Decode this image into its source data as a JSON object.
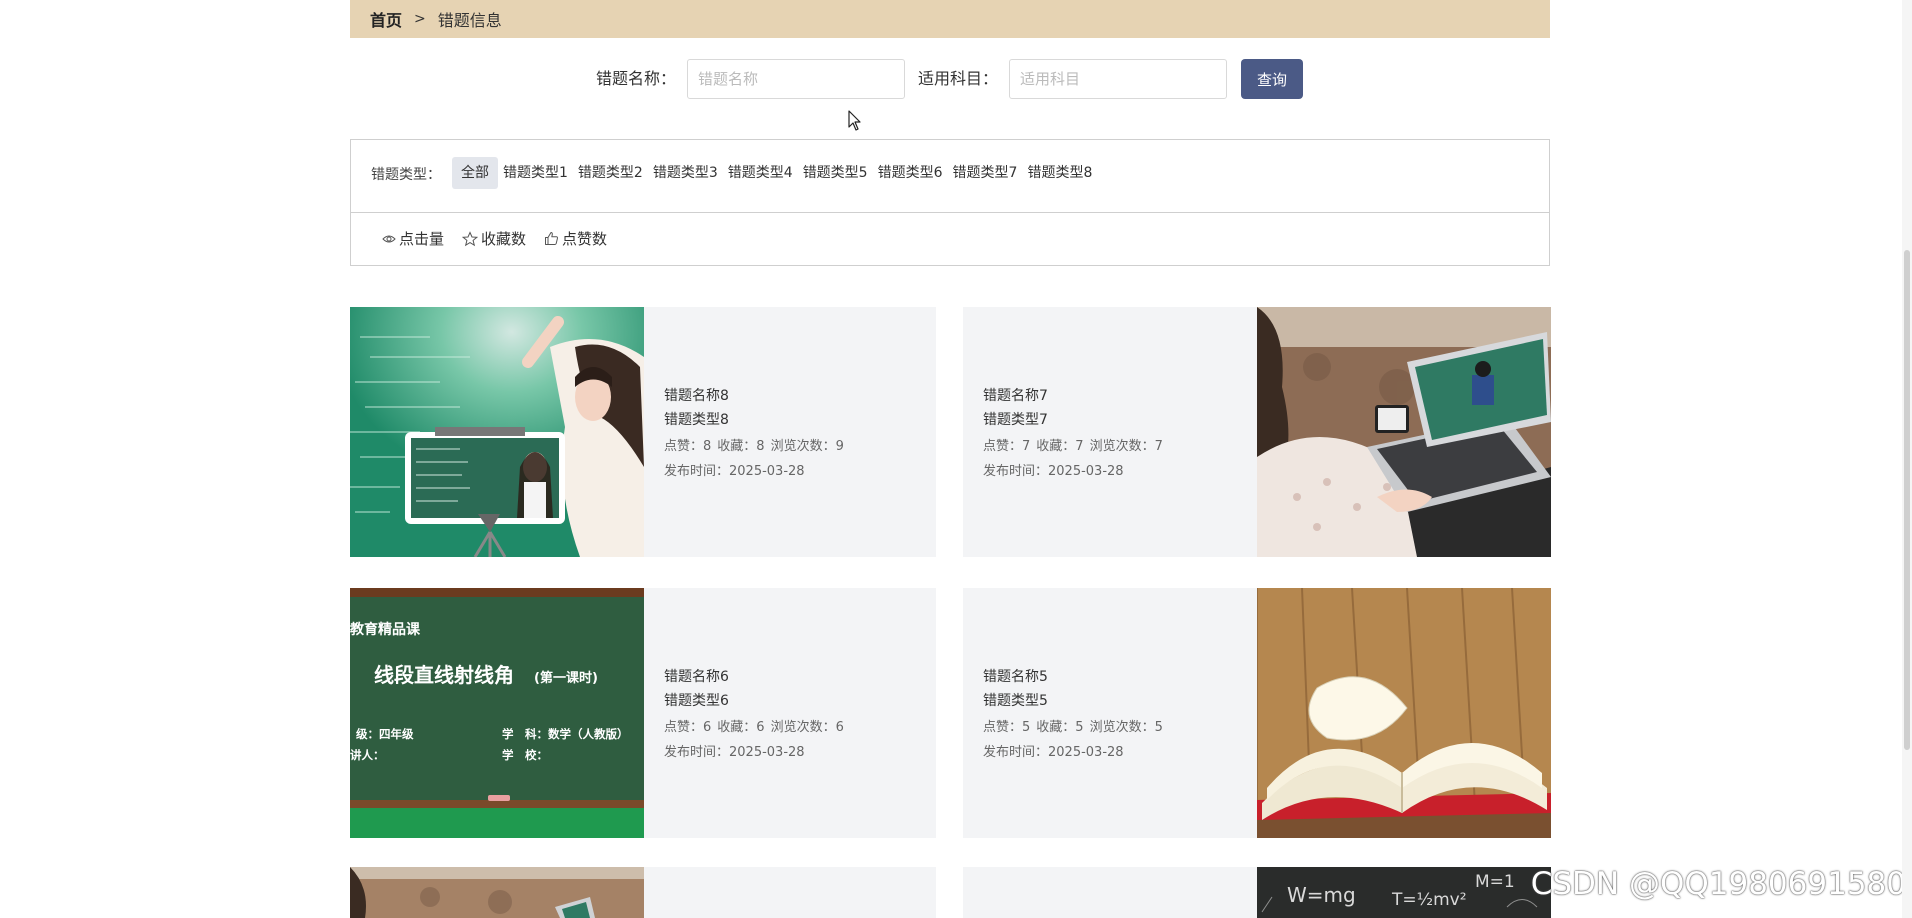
{
  "breadcrumb": {
    "home": "首页",
    "separator": ">",
    "current": "错题信息"
  },
  "search": {
    "name_label": "错题名称：",
    "name_placeholder": "错题名称",
    "subject_label": "适用科目：",
    "subject_placeholder": "适用科目",
    "query_label": "查询"
  },
  "filter": {
    "type_label": "错题类型：",
    "types": [
      "全部",
      "错题类型1",
      "错题类型2",
      "错题类型3",
      "错题类型4",
      "错题类型5",
      "错题类型6",
      "错题类型7",
      "错题类型8"
    ],
    "sorts": [
      {
        "icon": "eye-icon",
        "label": "点击量"
      },
      {
        "icon": "star-icon",
        "label": "收藏数"
      },
      {
        "icon": "thumbs-up-icon",
        "label": "点赞数"
      }
    ]
  },
  "cards": [
    {
      "name": "错题名称8",
      "type": "错题类型8",
      "likes": "点赞：8",
      "favorites": "收藏：8",
      "views": "浏览次数：9",
      "date": "发布时间：2025-03-28",
      "image": "teacher-chalkboard-photo"
    },
    {
      "name": "错题名称7",
      "type": "错题类型7",
      "likes": "点赞：7",
      "favorites": "收藏：7",
      "views": "浏览次数：7",
      "date": "发布时间：2025-03-28",
      "image": "laptop-online-class-photo"
    },
    {
      "name": "错题名称6",
      "type": "错题类型6",
      "likes": "点赞：6",
      "favorites": "收藏：6",
      "views": "浏览次数：6",
      "date": "发布时间：2025-03-28",
      "image": "lesson-blackboard-slide"
    },
    {
      "name": "错题名称5",
      "type": "错题类型5",
      "likes": "点赞：5",
      "favorites": "收藏：5",
      "views": "浏览次数：5",
      "date": "发布时间：2025-03-28",
      "image": "open-book-photo"
    }
  ],
  "slide": {
    "header": "教育精品课",
    "title": "线段直线射线角",
    "subtitle": "(第一课时)",
    "grade": "级：四年级",
    "subject": "学　科：数学（人教版）",
    "teacher": "讲人：",
    "school": "学　校："
  },
  "formula": {
    "w": "W=mg",
    "t": "T=½mv²",
    "m": "M=1"
  },
  "watermark": "CSDN @QQ1980691580",
  "colors": {
    "breadcrumb_bg": "#e6d3b3",
    "button": "#4b5a86",
    "card_bg": "#f3f4f6",
    "active_tag": "#e3e6ec"
  }
}
